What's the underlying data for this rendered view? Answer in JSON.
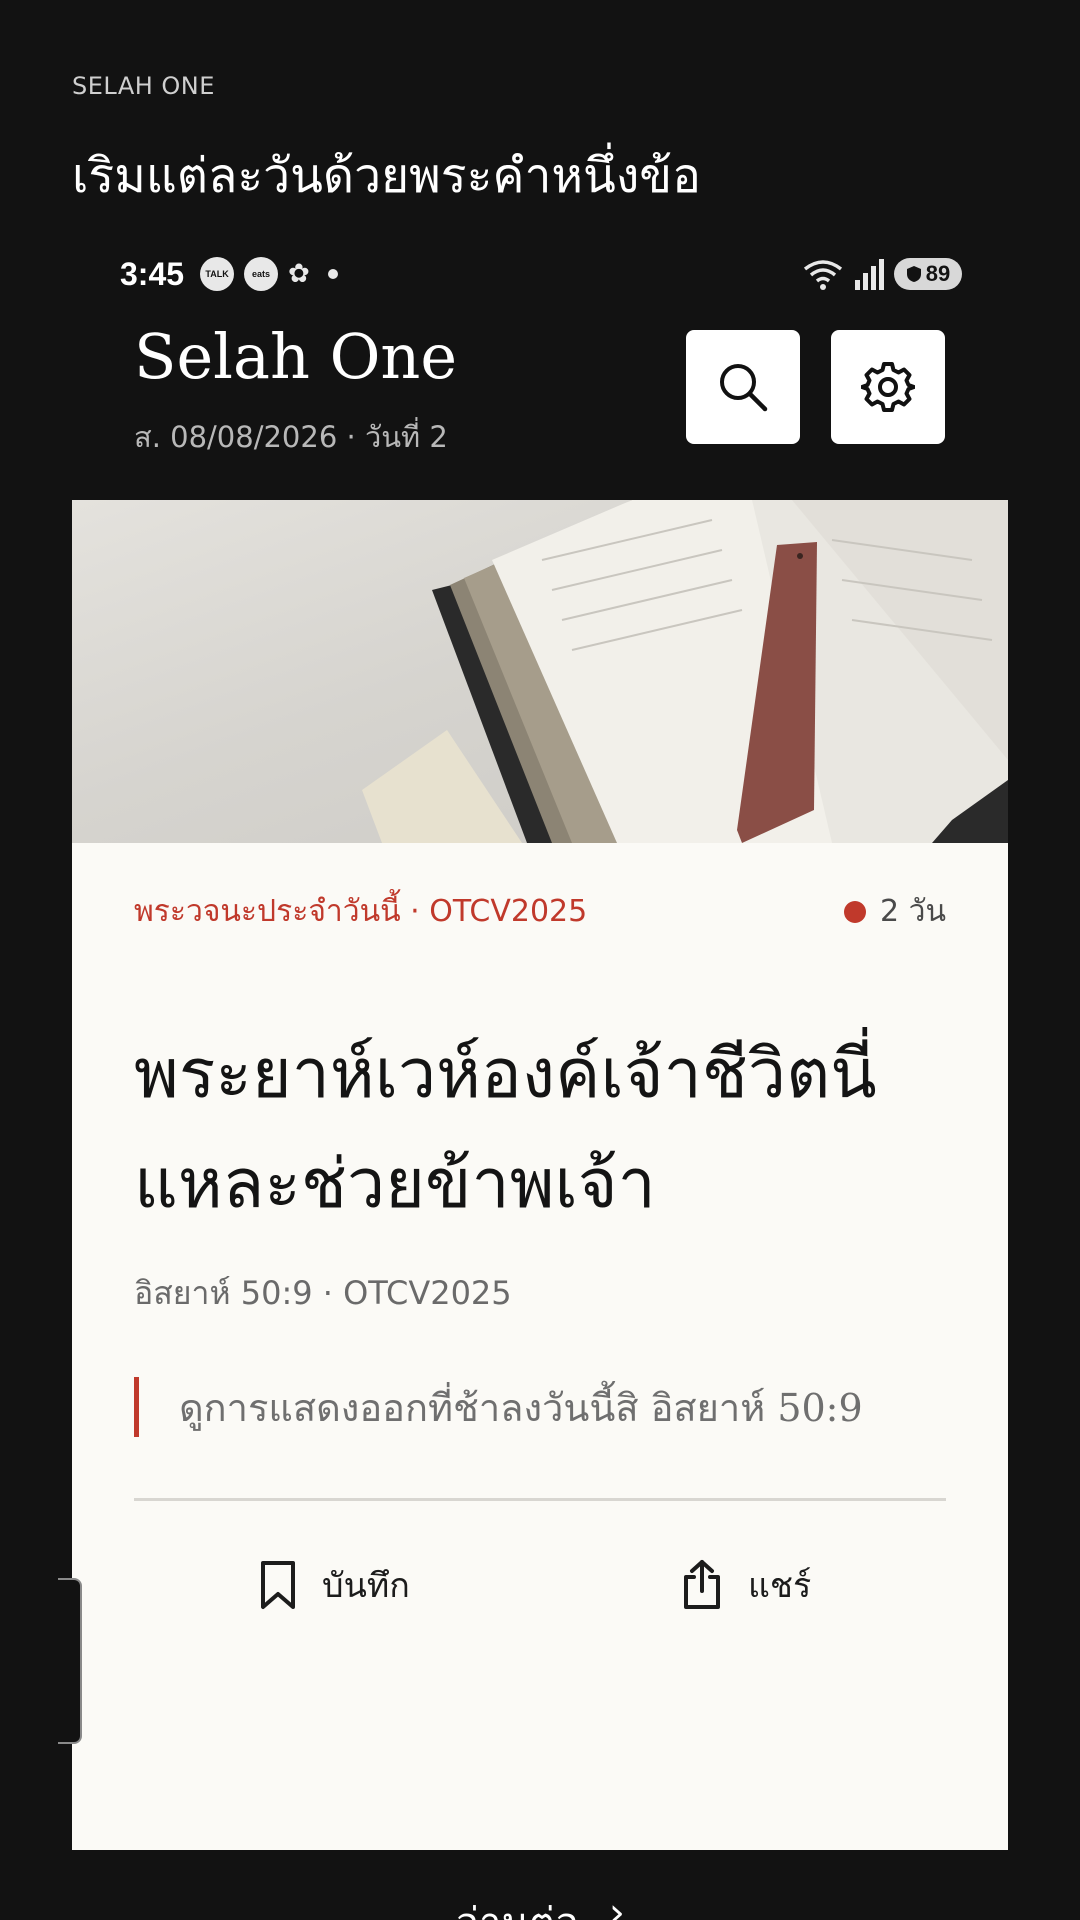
{
  "promo": {
    "eyebrow": "SELAH ONE",
    "title": "เริมแต่ละวันด้วยพระคำหนึ่งข้อ"
  },
  "status_bar": {
    "time": "3:45",
    "notifications": [
      "TALK",
      "eats",
      "flower-icon"
    ],
    "battery": "89"
  },
  "header": {
    "app_title": "Selah One",
    "date_line": "ส. 08/08/2026 · วันที่ 2",
    "search_icon": "search-icon",
    "settings_icon": "gear-icon"
  },
  "card": {
    "category": "พระวจนะประจำวันนี้ · OTCV2025",
    "streak": "2 วัน",
    "verse_title": "พระยาห์เวห์องค์เจ้าชีวิตนี่แหละช่วยข้าพเจ้า",
    "verse_ref": "อิสยาห์ 50:9 · OTCV2025",
    "quote": "ดูการแสดงออกที่ช้าลงวันนี้สิ อิสยาห์ 50:9",
    "save_label": "บันทึก",
    "share_label": "แชร์"
  },
  "footer": {
    "read_more": "อ่านต่อ"
  },
  "colors": {
    "background": "#121212",
    "card": "#fbfaf6",
    "accent": "#c0392b"
  }
}
